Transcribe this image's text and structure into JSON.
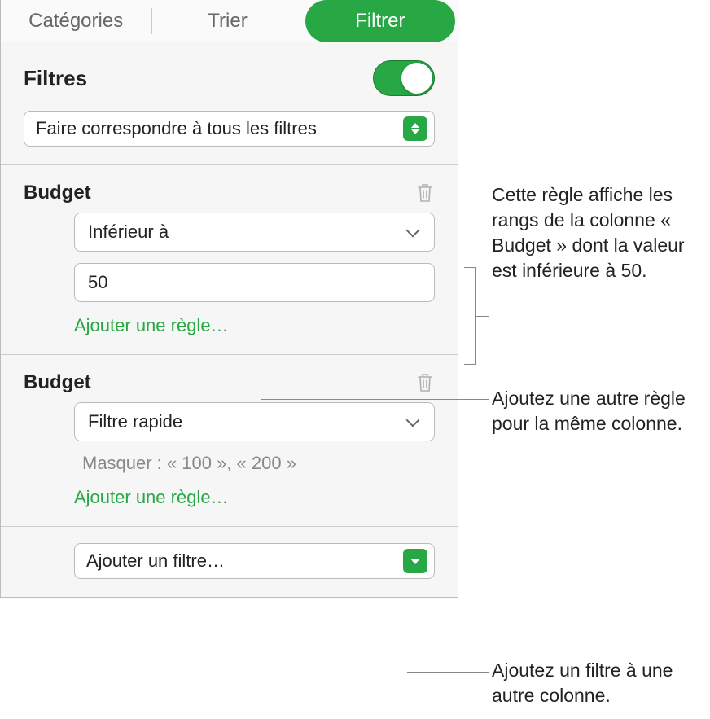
{
  "tabs": {
    "categories": "Catégories",
    "sort": "Trier",
    "filter": "Filtrer"
  },
  "filters": {
    "title": "Filtres",
    "match_mode": "Faire correspondre à tous les filtres"
  },
  "groups": [
    {
      "title": "Budget",
      "operator": "Inférieur à",
      "value": "50",
      "add_rule": "Ajouter une règle…"
    },
    {
      "title": "Budget",
      "operator": "Filtre rapide",
      "hint": "Masquer : « 100 », « 200 »",
      "add_rule": "Ajouter une règle…"
    }
  ],
  "add_filter": "Ajouter un filtre…",
  "callouts": {
    "rule_desc": "Cette règle affiche les rangs de la colonne « Budget » dont la valeur est inférieure à 50.",
    "add_rule_desc": "Ajoutez une autre règle pour la même colonne.",
    "add_filter_desc": "Ajoutez un filtre à une autre colonne."
  }
}
